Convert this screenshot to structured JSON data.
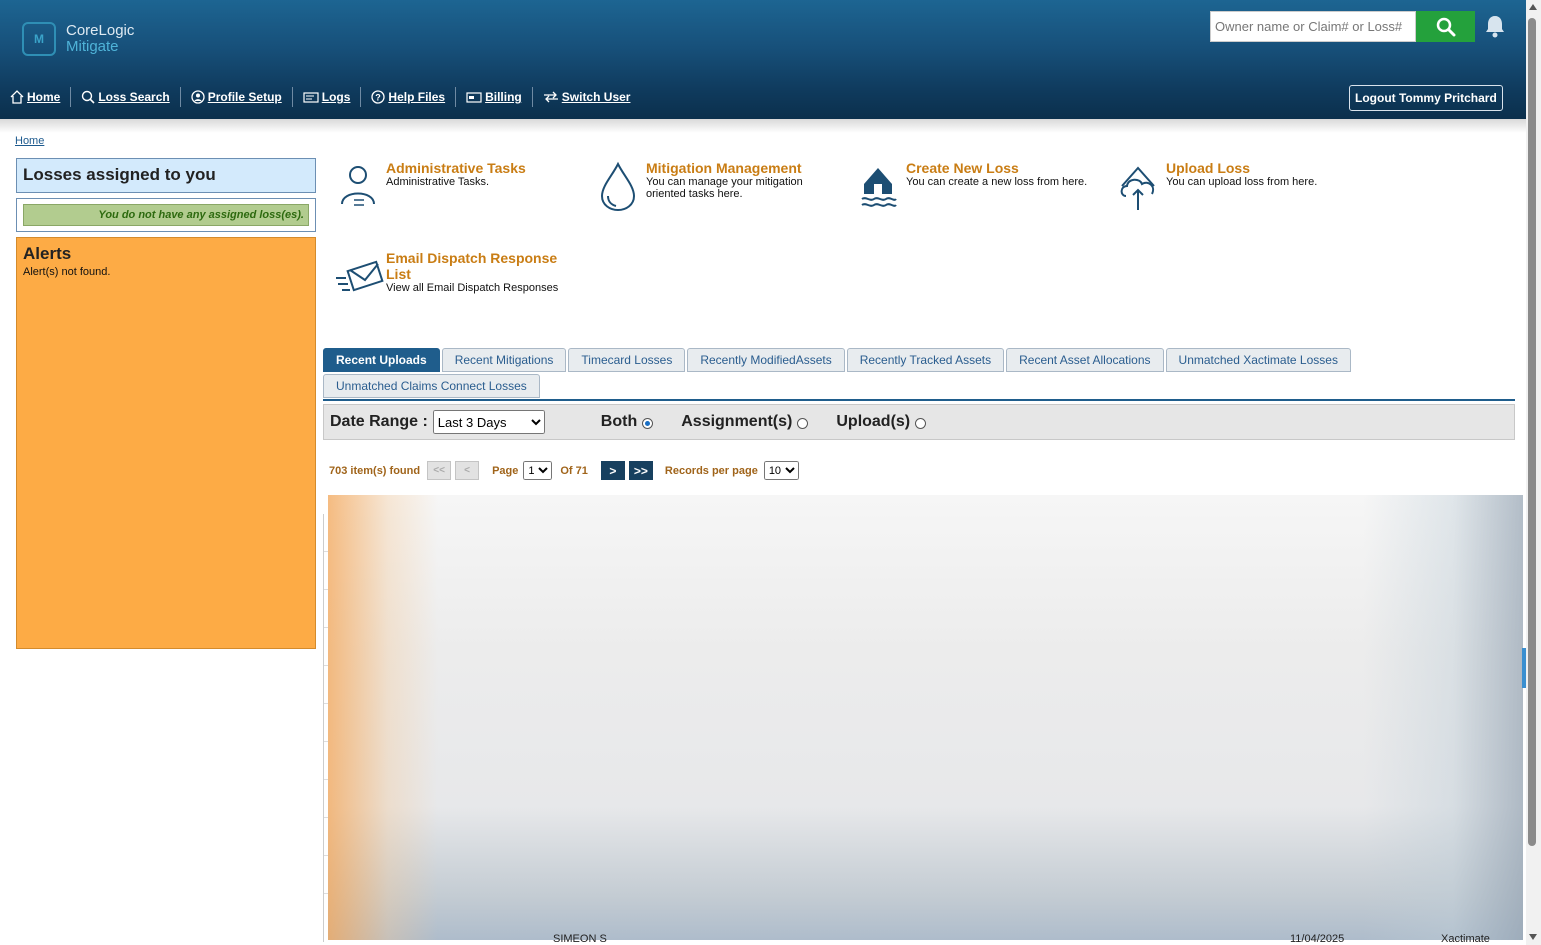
{
  "brand": {
    "line1": "CoreLogic",
    "line2": "Mitigate",
    "mark": "M"
  },
  "search": {
    "placeholder": "Owner name or Claim# or Loss#"
  },
  "nav": {
    "home": "Home",
    "loss_search": "Loss Search",
    "profile_setup": "Profile Setup",
    "logs": "Logs",
    "help_files": "Help Files",
    "billing": "Billing",
    "switch_user": "Switch User"
  },
  "logout_label": "Logout Tommy Pritchard",
  "breadcrumb": "Home",
  "losses_panel": {
    "title": "Losses assigned to you",
    "message": "You do not have any assigned loss(es)."
  },
  "alerts": {
    "title": "Alerts",
    "message": "Alert(s) not found."
  },
  "tiles": [
    {
      "title": "Administrative Tasks",
      "desc": "Administrative Tasks.",
      "icon": "admin-person-icon"
    },
    {
      "title": "Mitigation Management",
      "desc": "You can manage your mitigation oriented tasks here.",
      "icon": "water-drop-icon"
    },
    {
      "title": "Create New Loss",
      "desc": "You can create a new loss from here.",
      "icon": "flooded-house-icon"
    },
    {
      "title": "Upload Loss",
      "desc": "You can upload loss from here.",
      "icon": "house-upload-icon"
    },
    {
      "title": "Email Dispatch Response List",
      "desc": "View all Email Dispatch Responses",
      "icon": "envelope-icon"
    }
  ],
  "tabs": [
    {
      "label": "Recent Uploads",
      "active": true
    },
    {
      "label": "Recent Mitigations"
    },
    {
      "label": "Timecard Losses"
    },
    {
      "label": "Recently ModifiedAssets"
    },
    {
      "label": "Recently Tracked Assets"
    },
    {
      "label": "Recent Asset Allocations"
    },
    {
      "label": "Unmatched Xactimate Losses"
    },
    {
      "label": "Unmatched Claims Connect Losses"
    }
  ],
  "filter": {
    "date_range_label": "Date Range :",
    "date_range_value": "Last 3 Days",
    "radios": [
      {
        "label": "Both",
        "checked": true
      },
      {
        "label": "Assignment(s)"
      },
      {
        "label": "Upload(s)"
      }
    ]
  },
  "pager": {
    "found": "703 item(s) found",
    "first": "<<",
    "prev": "<",
    "page_label": "Page",
    "page_value": "1",
    "of": "Of 71",
    "next": ">",
    "last": ">>",
    "rpp_label": "Records per page",
    "rpp_value": "10"
  },
  "table_fragments": {
    "a": "SIMEON S",
    "b": "11/04/2025",
    "c": "Xactimate"
  },
  "colors": {
    "accent": "#1f5d8c",
    "orange": "#fdab45",
    "tile_title": "#c97d14",
    "search_btn": "#24a13c"
  }
}
